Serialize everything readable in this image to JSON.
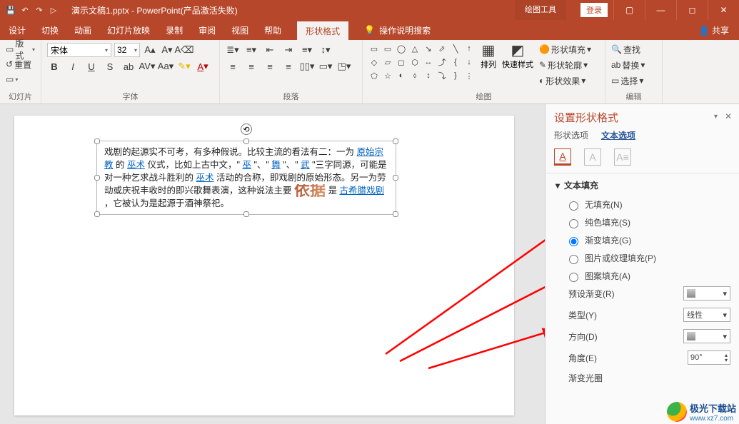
{
  "title": "演示文稿1.pptx - PowerPoint(产品激活失败)",
  "titlebar": {
    "login": "登录",
    "context_tab_group": "绘图工具"
  },
  "menubar": {
    "items": [
      "设计",
      "切换",
      "动画",
      "幻灯片放映",
      "录制",
      "审阅",
      "视图",
      "帮助"
    ],
    "active": "形状格式",
    "tell_me": "操作说明搜索",
    "share": "共享"
  },
  "ribbon": {
    "clipboard": {
      "style_dd": "版式",
      "reset": "重置",
      "group": "幻灯片"
    },
    "font": {
      "name": "宋体",
      "size": "32",
      "group": "字体"
    },
    "paragraph": {
      "group": "段落"
    },
    "drawing": {
      "group": "绘图",
      "arrange": "排列",
      "quickstyle": "快速样式",
      "shape_fill": "形状填充",
      "shape_outline": "形状轮廓",
      "shape_effects": "形状效果"
    },
    "editing": {
      "group": "编辑",
      "find": "查找",
      "replace": "替换",
      "select": "选择"
    }
  },
  "slide": {
    "text1": "戏剧的起源实不可考，有多种假说。比较主流的看法有二：一为",
    "link1": "原始宗教",
    "text2": "的",
    "link2": "巫术",
    "text3": "仪式，比如上古中文，\"",
    "link3": "巫",
    "text4": "\"、\"",
    "link4": "舞",
    "text5": "\"、\"",
    "link5": "武",
    "text6": "\"三字同源，可能是对一种乞求战斗胜利的",
    "link6": "巫术",
    "text7": "活动的合称，即戏剧的原始形态。另一为劳动或庆祝丰收时的即兴歌舞表演，这种说法主要",
    "big_word": "依据",
    "text8": "是",
    "link7": "古希腊戏剧",
    "text9": "，它被认为是起源于酒神祭祀。"
  },
  "panel": {
    "title": "设置形状格式",
    "tab_shape": "形状选项",
    "tab_text": "文本选项",
    "section_fill": "文本填充",
    "opt_none": "无填充(N)",
    "opt_solid": "纯色填充(S)",
    "opt_gradient": "渐变填充(G)",
    "opt_picture": "图片或纹理填充(P)",
    "opt_pattern": "图案填充(A)",
    "preset": "预设渐变(R)",
    "type": "类型(Y)",
    "type_val": "线性",
    "direction": "方向(D)",
    "angle": "角度(E)",
    "angle_val": "90°",
    "stops": "渐变光圈"
  },
  "watermark": {
    "site": "极光下载站",
    "url": "www.xz7.com"
  }
}
